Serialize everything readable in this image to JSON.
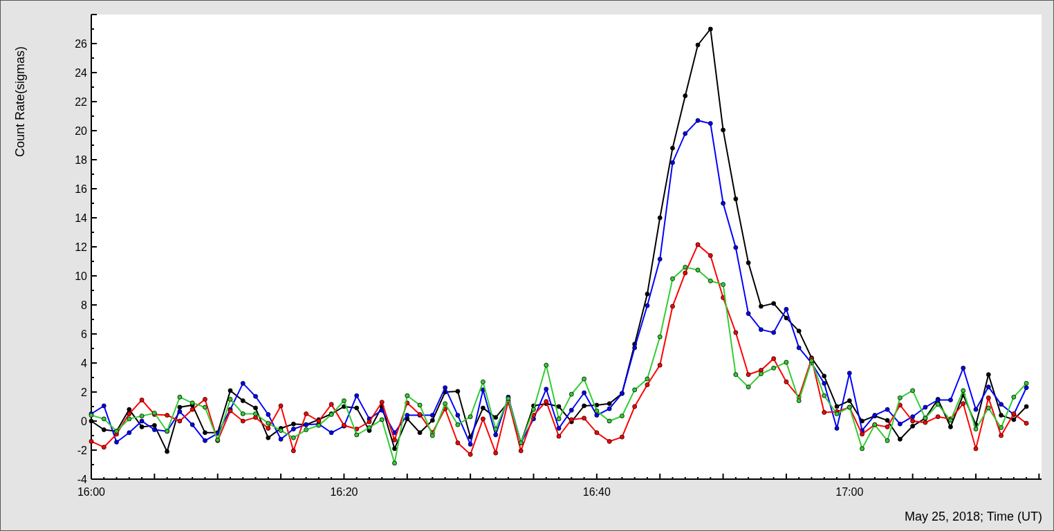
{
  "chart_data": {
    "type": "line",
    "xlabel": "May 25, 2018; Time (UT)",
    "ylabel": "Count Rate(sigmas)",
    "categories": [
      "16:00",
      null,
      null,
      null,
      null,
      null,
      null,
      null,
      null,
      null,
      null,
      null,
      null,
      null,
      null,
      null,
      null,
      null,
      null,
      null,
      "16:20",
      null,
      null,
      null,
      null,
      null,
      null,
      null,
      null,
      null,
      null,
      null,
      null,
      null,
      null,
      null,
      null,
      null,
      null,
      null,
      "16:40",
      null,
      null,
      null,
      null,
      null,
      null,
      null,
      null,
      null,
      null,
      null,
      null,
      null,
      null,
      null,
      null,
      null,
      null,
      null,
      "17:00",
      null,
      null,
      null,
      null,
      null,
      null,
      null,
      null,
      null,
      null,
      null,
      null,
      null,
      null
    ],
    "ylim": [
      -4,
      28
    ],
    "yticks": [
      -4,
      -2,
      0,
      2,
      4,
      6,
      8,
      10,
      12,
      14,
      16,
      18,
      20,
      22,
      24,
      26
    ],
    "series": [
      {
        "color": "#000000",
        "marker": "circle",
        "values": [
          0,
          -0.6,
          -0.7,
          0.8,
          -0.4,
          -0.3,
          -2.1,
          0.95,
          1.1,
          -0.8,
          -0.8,
          2.1,
          1.4,
          0.9,
          -1.15,
          -0.5,
          -0.2,
          -0.25,
          0.1,
          0.5,
          1.0,
          0.9,
          -0.65,
          1.0,
          -1.9,
          0.15,
          -0.8,
          0.05,
          2.0,
          2.05,
          -1.1,
          0.9,
          0.25,
          1.3,
          -1.5,
          1.05,
          1.2,
          1.0,
          -0.05,
          1.05,
          1.1,
          1.2,
          1.9,
          5.3,
          8.75,
          14.0,
          18.8,
          22.4,
          25.9,
          27.0,
          20.05,
          15.3,
          10.9,
          7.9,
          8.1,
          7.1,
          6.2,
          4.35,
          3.1,
          1.0,
          1.4,
          0,
          0.35,
          0.05,
          -1.25,
          -0.35,
          0.2,
          1.5,
          -0.4,
          1.8,
          -0.25,
          3.2,
          0.4,
          0.1,
          1.0
        ]
      },
      {
        "color": "#0000ff",
        "marker": "circle",
        "values": [
          0.5,
          1.05,
          -1.45,
          -0.8,
          0,
          -0.6,
          -0.7,
          0.65,
          -0.25,
          -1.35,
          -0.85,
          0.8,
          2.6,
          1.7,
          0.45,
          -1.25,
          -0.55,
          -0.25,
          -0.2,
          -0.8,
          -0.35,
          1.75,
          0.15,
          0.75,
          -0.8,
          0.4,
          0.4,
          0.4,
          2.3,
          0.4,
          -1.6,
          2.15,
          -0.95,
          1.65,
          -1.5,
          0.15,
          2.2,
          -0.5,
          0.75,
          1.95,
          0.4,
          0.85,
          1.9,
          5.05,
          7.95,
          11.15,
          17.8,
          19.8,
          20.7,
          20.5,
          15.0,
          11.95,
          7.4,
          6.3,
          6.1,
          7.7,
          5.05,
          4.0,
          2.6,
          -0.5,
          3.3,
          -0.65,
          0.4,
          0.8,
          -0.2,
          0.3,
          0.95,
          1.45,
          1.45,
          3.65,
          0.8,
          2.35,
          1.15,
          0.45,
          2.3
        ]
      },
      {
        "color": "#ff0000",
        "marker": "circle",
        "values": [
          -1.4,
          -1.8,
          -0.9,
          0.5,
          1.45,
          0.45,
          0.4,
          0,
          0.8,
          1.5,
          -1.35,
          0.7,
          0,
          0.25,
          -0.5,
          1.05,
          -2.05,
          0.5,
          0,
          1.15,
          -0.3,
          -0.55,
          -0.05,
          1.3,
          -1.3,
          1.25,
          0.45,
          -0.8,
          0.85,
          -1.5,
          -2.3,
          0.15,
          -2.2,
          1.4,
          -2.05,
          0.4,
          1.35,
          -1.05,
          0.1,
          0.2,
          -0.8,
          -1.4,
          -1.1,
          1.0,
          2.5,
          3.85,
          7.9,
          10.2,
          12.15,
          11.4,
          8.5,
          6.1,
          3.2,
          3.5,
          4.3,
          2.7,
          1.65,
          4.3,
          0.6,
          0.65,
          0.95,
          -0.9,
          -0.25,
          -0.4,
          1.1,
          0,
          -0.1,
          0.3,
          0.15,
          1.2,
          -1.9,
          1.6,
          -1.0,
          0.5,
          -0.15
        ]
      },
      {
        "color": "#33cc33",
        "marker": "circle",
        "values": [
          0.4,
          0.15,
          -0.7,
          0.15,
          0.35,
          0.55,
          -0.7,
          1.65,
          1.25,
          0.95,
          -1.3,
          1.5,
          0.5,
          0.5,
          -0.15,
          -0.65,
          -1.15,
          -0.6,
          -0.3,
          0.45,
          1.4,
          -0.95,
          -0.45,
          0.1,
          -2.9,
          1.75,
          1.1,
          -1.0,
          1.2,
          -0.25,
          0.3,
          2.7,
          -0.55,
          1.55,
          -1.5,
          0.8,
          3.85,
          0.15,
          1.85,
          2.9,
          0.7,
          0,
          0.35,
          2.15,
          2.9,
          5.8,
          9.8,
          10.6,
          10.4,
          9.65,
          9.4,
          3.2,
          2.35,
          3.25,
          3.65,
          4.05,
          1.4,
          4.15,
          1.75,
          0.5,
          0.95,
          -1.9,
          -0.25,
          -1.35,
          1.6,
          2.1,
          0.2,
          1.15,
          0.05,
          2.1,
          -0.55,
          0.9,
          -0.45,
          1.65,
          2.6
        ]
      }
    ]
  }
}
